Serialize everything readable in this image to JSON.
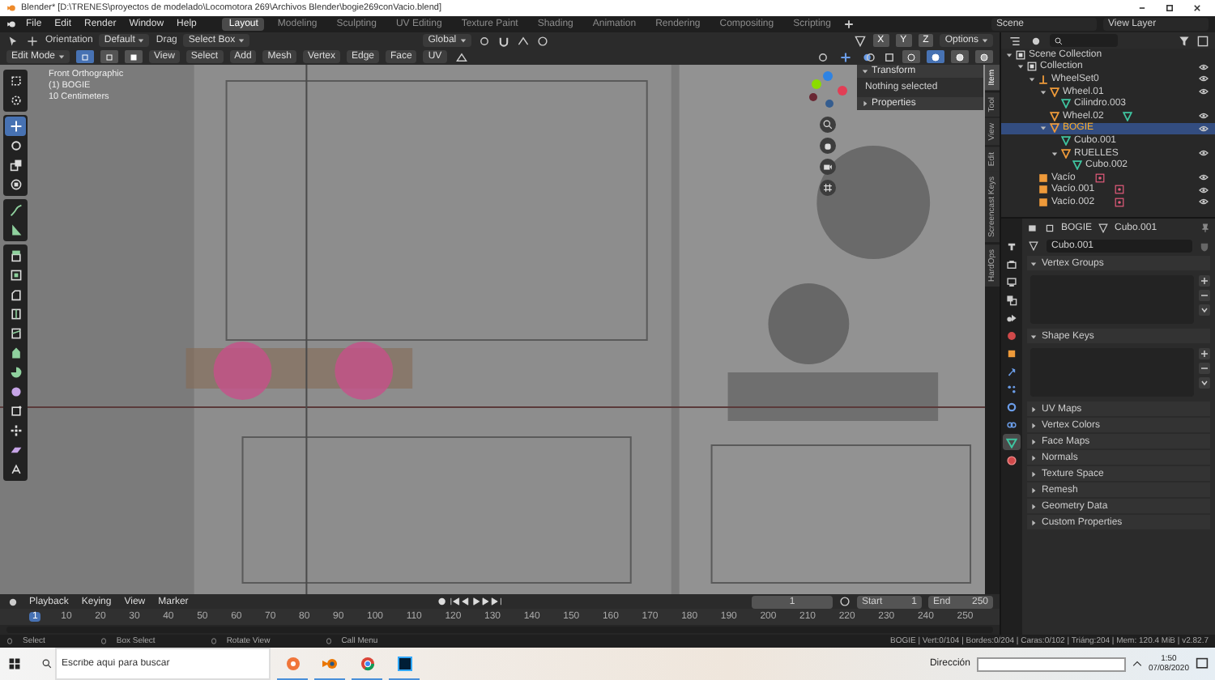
{
  "window": {
    "title": "Blender* [D:\\TRENES\\proyectos de modelado\\Locomotora 269\\Archivos Blender\\bogie269conVacio.blend]"
  },
  "menu": [
    "File",
    "Edit",
    "Render",
    "Window",
    "Help"
  ],
  "workspaces": [
    {
      "label": "Layout",
      "selected": true
    },
    {
      "label": "Modeling",
      "selected": false
    },
    {
      "label": "Sculpting",
      "selected": false
    },
    {
      "label": "UV Editing",
      "selected": false
    },
    {
      "label": "Texture Paint",
      "selected": false
    },
    {
      "label": "Shading",
      "selected": false
    },
    {
      "label": "Animation",
      "selected": false
    },
    {
      "label": "Rendering",
      "selected": false
    },
    {
      "label": "Compositing",
      "selected": false
    },
    {
      "label": "Scripting",
      "selected": false
    }
  ],
  "scene": "Scene",
  "view_layer": "View Layer",
  "tool_header": {
    "orientation": "Orientation",
    "pivot": "Default",
    "drag": "Drag",
    "select_tool": "Select Box",
    "transform_orientation": "Global",
    "mirror_axes": [
      {
        "label": "X",
        "on": false
      },
      {
        "label": "Y",
        "on": false
      },
      {
        "label": "Z",
        "on": false
      }
    ],
    "options": "Options"
  },
  "viewport": {
    "mode": "Edit Mode",
    "select_modes": [
      {
        "selected": true
      },
      {
        "selected": false
      },
      {
        "selected": false
      }
    ],
    "menus": [
      "View",
      "Select",
      "Add",
      "Mesh",
      "Vertex",
      "Edge",
      "Face",
      "UV"
    ],
    "shading": [
      {
        "selected": false
      },
      {
        "selected": true
      },
      {
        "selected": false
      },
      {
        "selected": false
      }
    ],
    "overlay_text": [
      "Front Orthographic",
      "(1) BOGIE",
      "10 Centimeters"
    ],
    "tool_groups": [
      {
        "tools": [
          {
            "kind": "select",
            "selected": false
          },
          {
            "kind": "cursor",
            "selected": false
          }
        ]
      },
      {
        "tools": [
          {
            "kind": "move",
            "selected": true
          },
          {
            "kind": "rotate",
            "selected": false
          },
          {
            "kind": "scale",
            "selected": false
          },
          {
            "kind": "transform",
            "selected": false
          }
        ]
      },
      {
        "tools": [
          {
            "kind": "annotate",
            "selected": false
          },
          {
            "kind": "measure",
            "selected": false
          }
        ]
      },
      {
        "tools": [
          {
            "kind": "extrude",
            "selected": false
          },
          {
            "kind": "inset",
            "selected": false
          },
          {
            "kind": "bevel",
            "selected": false
          },
          {
            "kind": "loopcut",
            "selected": false
          },
          {
            "kind": "knife",
            "selected": false
          },
          {
            "kind": "polybuild",
            "selected": false
          },
          {
            "kind": "spin",
            "selected": false
          },
          {
            "kind": "smooth",
            "selected": false
          },
          {
            "kind": "edgeslide",
            "selected": false
          },
          {
            "kind": "shrink",
            "selected": false
          },
          {
            "kind": "shear",
            "selected": false
          },
          {
            "kind": "rip",
            "selected": false
          }
        ]
      }
    ]
  },
  "n_panel": {
    "tabs": [
      {
        "label": "Item",
        "selected": true
      },
      {
        "label": "Tool",
        "selected": false
      },
      {
        "label": "View",
        "selected": false
      },
      {
        "label": "Edit",
        "selected": false
      },
      {
        "label": "Screencast Keys",
        "selected": false
      },
      {
        "label": "HardOps",
        "selected": false
      }
    ],
    "sections": [
      {
        "title": "Transform",
        "expanded": true,
        "text": "Nothing selected"
      },
      {
        "title": "Properties",
        "expanded": false
      }
    ]
  },
  "outliner": {
    "items": [
      {
        "label": "Scene Collection",
        "kind": "collection",
        "selected": false,
        "children": [
          {
            "label": "Collection",
            "kind": "collection",
            "selected": false,
            "visible": true,
            "children": [
              {
                "label": "WheelSet0",
                "kind": "empty",
                "selected": false,
                "visible": true,
                "children": [
                  {
                    "label": "Wheel.01",
                    "kind": "object",
                    "selected": false,
                    "visible": true,
                    "children": [
                      {
                        "label": "Cilindro.003",
                        "kind": "mesh",
                        "selected": false
                      }
                    ]
                  },
                  {
                    "label": "Wheel.02",
                    "kind": "object",
                    "selected": false,
                    "visible": true,
                    "data": {
                      "kind": "mesh"
                    }
                  },
                  {
                    "label": "BOGIE",
                    "kind": "object",
                    "selected": true,
                    "visible": true,
                    "children": [
                      {
                        "label": "Cubo.001",
                        "kind": "mesh",
                        "selected": false
                      },
                      {
                        "label": "RUELLES",
                        "kind": "object",
                        "selected": false,
                        "visible": true,
                        "children": [
                          {
                            "label": "Cubo.002",
                            "kind": "mesh",
                            "selected": false
                          }
                        ]
                      }
                    ]
                  }
                ]
              },
              {
                "label": "Vacío",
                "kind": "empty_object",
                "selected": false,
                "visible": true,
                "data": {
                  "kind": "empty"
                }
              },
              {
                "label": "Vacío.001",
                "kind": "empty_object",
                "selected": false,
                "visible": true,
                "data": {
                  "kind": "empty"
                }
              },
              {
                "label": "Vacío.002",
                "kind": "empty_object",
                "selected": false,
                "visible": true,
                "data": {
                  "kind": "empty"
                }
              }
            ]
          }
        ]
      }
    ]
  },
  "properties": {
    "object": "BOGIE",
    "data": "Cubo.001",
    "data_name": "Cubo.001",
    "tabs": [
      {
        "kind": "tool",
        "selected": false
      },
      {
        "kind": "render",
        "selected": false
      },
      {
        "kind": "output",
        "selected": false
      },
      {
        "kind": "view_layer",
        "selected": false
      },
      {
        "kind": "scene",
        "selected": false
      },
      {
        "kind": "world",
        "selected": false
      },
      {
        "kind": "object",
        "selected": false
      },
      {
        "kind": "modifiers",
        "selected": false
      },
      {
        "kind": "particles",
        "selected": false
      },
      {
        "kind": "physics",
        "selected": false
      },
      {
        "kind": "constraints",
        "selected": false
      },
      {
        "kind": "data",
        "selected": true
      },
      {
        "kind": "material",
        "selected": false
      }
    ],
    "panels": [
      {
        "title": "Vertex Groups",
        "expanded": true
      },
      {
        "title": "Shape Keys",
        "expanded": true
      },
      {
        "title": "UV Maps",
        "expanded": false
      },
      {
        "title": "Vertex Colors",
        "expanded": false
      },
      {
        "title": "Face Maps",
        "expanded": false
      },
      {
        "title": "Normals",
        "expanded": false
      },
      {
        "title": "Texture Space",
        "expanded": false
      },
      {
        "title": "Remesh",
        "expanded": false
      },
      {
        "title": "Geometry Data",
        "expanded": false
      },
      {
        "title": "Custom Properties",
        "expanded": false
      }
    ]
  },
  "timeline": {
    "menus": [
      "Playback",
      "Keying",
      "View",
      "Marker"
    ],
    "current_frame": "1",
    "start_label": "Start",
    "start": "1",
    "end_label": "End",
    "end": "250",
    "ticks": [
      {
        "label": "1",
        "selected": true
      },
      {
        "label": "10",
        "selected": false
      },
      {
        "label": "20",
        "selected": false
      },
      {
        "label": "30",
        "selected": false
      },
      {
        "label": "40",
        "selected": false
      },
      {
        "label": "50",
        "selected": false
      },
      {
        "label": "60",
        "selected": false
      },
      {
        "label": "70",
        "selected": false
      },
      {
        "label": "80",
        "selected": false
      },
      {
        "label": "90",
        "selected": false
      },
      {
        "label": "100",
        "selected": false
      },
      {
        "label": "110",
        "selected": false
      },
      {
        "label": "120",
        "selected": false
      },
      {
        "label": "130",
        "selected": false
      },
      {
        "label": "140",
        "selected": false
      },
      {
        "label": "150",
        "selected": false
      },
      {
        "label": "160",
        "selected": false
      },
      {
        "label": "170",
        "selected": false
      },
      {
        "label": "180",
        "selected": false
      },
      {
        "label": "190",
        "selected": false
      },
      {
        "label": "200",
        "selected": false
      },
      {
        "label": "210",
        "selected": false
      },
      {
        "label": "220",
        "selected": false
      },
      {
        "label": "230",
        "selected": false
      },
      {
        "label": "240",
        "selected": false
      },
      {
        "label": "250",
        "selected": false
      }
    ]
  },
  "status_bar": {
    "actions": [
      "Select",
      "Box Select",
      "Rotate View",
      "Call Menu"
    ],
    "stats": "BOGIE | Vert:0/104 | Bordes:0/204 | Caras:0/102 | Triáng:204 | Mem: 120.4 MiB | v2.82.7"
  },
  "taskbar": {
    "search_placeholder": "Escribe aquí para buscar",
    "address_label": "Dirección",
    "time": "1:50",
    "date": "07/08/2020"
  }
}
